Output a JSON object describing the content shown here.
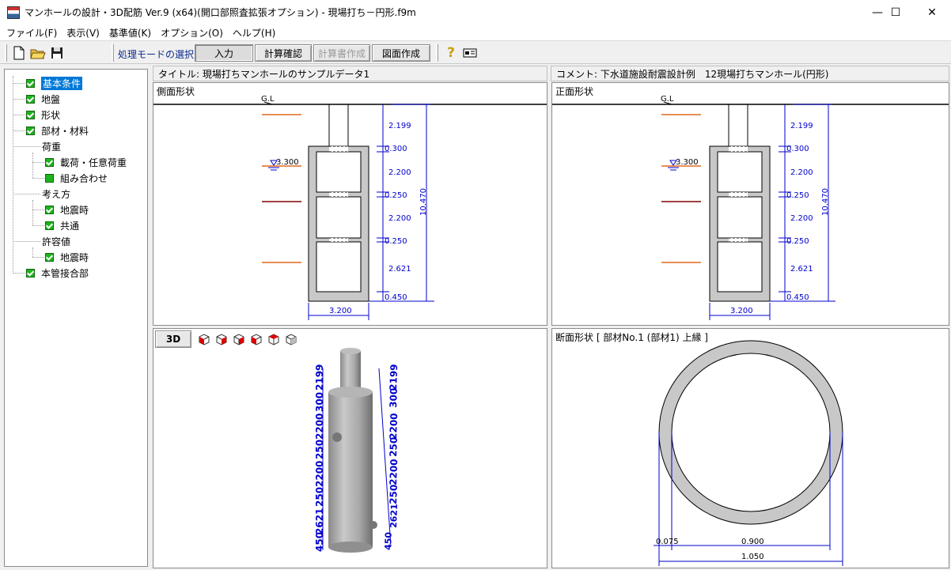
{
  "window": {
    "title": "マンホールの設計・3D配筋 Ver.9 (x64)(開口部照査拡張オプション) - 現場打ち－円形.f9m",
    "minimize": "—",
    "maximize": "☐",
    "close": "✕"
  },
  "menu": [
    "ファイル(F)",
    "表示(V)",
    "基準値(K)",
    "オプション(O)",
    "ヘルプ(H)"
  ],
  "toolbar": {
    "mode_label": "処理モードの選択",
    "buttons": [
      "入力",
      "計算確認",
      "計算書作成",
      "図面作成"
    ]
  },
  "tree": [
    {
      "label": "基本条件",
      "selected": true
    },
    {
      "label": "地盤"
    },
    {
      "label": "形状"
    },
    {
      "label": "部材・材料"
    },
    {
      "label": "荷重"
    },
    {
      "label": "載荷・任意荷重"
    },
    {
      "label": "組み合わせ"
    },
    {
      "label": "考え方"
    },
    {
      "label": "地震時"
    },
    {
      "label": "共通"
    },
    {
      "label": "許容値"
    },
    {
      "label": "地震時"
    },
    {
      "label": "本管接合部"
    }
  ],
  "header": {
    "title": "タイトル: 現場打ちマンホールのサンプルデータ1",
    "comment": "コメント: 下水道施設耐震設計例　12現場打ちマンホール(円形)"
  },
  "side_view": {
    "label": "側面形状",
    "gl": "G.L",
    "water_level": "3.300",
    "dims": [
      "2.199",
      "0.300",
      "2.200",
      "0.250",
      "2.200",
      "0.250",
      "2.621",
      "0.450"
    ],
    "total": "10.470",
    "width": "3.200"
  },
  "front_view": {
    "label": "正面形状",
    "gl": "G.L",
    "water_level": "3.300",
    "dims": [
      "2.199",
      "0.300",
      "2.200",
      "0.250",
      "2.200",
      "0.250",
      "2.621",
      "0.450"
    ],
    "total": "10.470",
    "width": "3.200"
  },
  "view3d": {
    "button": "3D",
    "labels_right": [
      "2199",
      "300",
      "2200",
      "250",
      "2200",
      "250",
      "2621",
      "450"
    ],
    "labels_left": [
      "2199",
      "300",
      "2200",
      "250",
      "2200",
      "250",
      "2621",
      "450"
    ]
  },
  "section": {
    "label": "断面形状 [ 部材No.1 (部材1) 上縁 ]",
    "dim_thickness": "0.075",
    "dim_inner": "0.900",
    "dim_outer": "1.050"
  },
  "colors": {
    "dim_blue": "#0000cc",
    "soil_orange": "#e06a1a",
    "soil_dark": "#800000",
    "check_green": "#1db31d",
    "select_blue": "#0078d7"
  }
}
